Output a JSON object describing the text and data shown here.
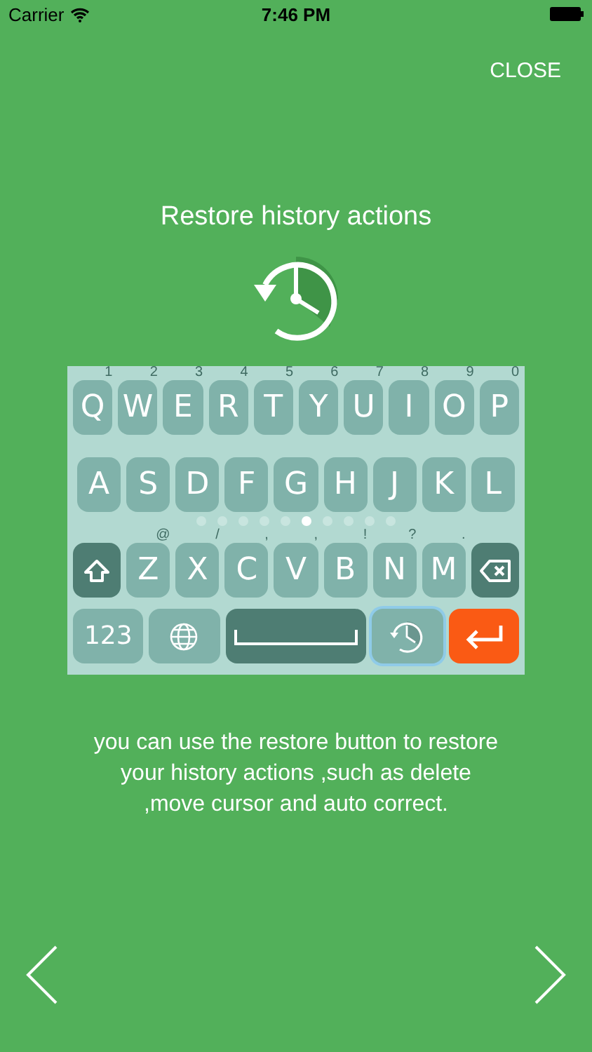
{
  "status_bar": {
    "carrier": "Carrier",
    "time": "7:46 PM"
  },
  "close": "CLOSE",
  "title": "Restore history actions",
  "keyboard": {
    "rows": [
      {
        "keys": [
          {
            "kind": "letter",
            "label": "Q",
            "hint": "1"
          },
          {
            "kind": "letter",
            "label": "W",
            "hint": "2"
          },
          {
            "kind": "letter",
            "label": "E",
            "hint": "3"
          },
          {
            "kind": "letter",
            "label": "R",
            "hint": "4"
          },
          {
            "kind": "letter",
            "label": "T",
            "hint": "5"
          },
          {
            "kind": "letter",
            "label": "Y",
            "hint": "6"
          },
          {
            "kind": "letter",
            "label": "U",
            "hint": "7"
          },
          {
            "kind": "letter",
            "label": "I",
            "hint": "8"
          },
          {
            "kind": "letter",
            "label": "O",
            "hint": "9"
          },
          {
            "kind": "letter",
            "label": "P",
            "hint": "0"
          }
        ]
      },
      {
        "keys": [
          {
            "kind": "letter",
            "label": "A"
          },
          {
            "kind": "letter",
            "label": "S"
          },
          {
            "kind": "letter",
            "label": "D"
          },
          {
            "kind": "letter",
            "label": "F"
          },
          {
            "kind": "letter",
            "label": "G"
          },
          {
            "kind": "letter",
            "label": "H"
          },
          {
            "kind": "letter",
            "label": "J"
          },
          {
            "kind": "letter",
            "label": "K"
          },
          {
            "kind": "letter",
            "label": "L"
          }
        ]
      },
      {
        "keys": [
          {
            "kind": "shift"
          },
          {
            "kind": "letter",
            "label": "Z",
            "hint": "@"
          },
          {
            "kind": "letter",
            "label": "X",
            "hint": "/"
          },
          {
            "kind": "letter",
            "label": "C",
            "hint": ","
          },
          {
            "kind": "letter",
            "label": "V",
            "hint": ","
          },
          {
            "kind": "letter",
            "label": "B",
            "hint": "!"
          },
          {
            "kind": "letter",
            "label": "N",
            "hint": "?"
          },
          {
            "kind": "letter",
            "label": "M",
            "hint": "."
          },
          {
            "kind": "backspace"
          }
        ]
      },
      {
        "keys": [
          {
            "kind": "numbers",
            "label": "123"
          },
          {
            "kind": "globe"
          },
          {
            "kind": "space"
          },
          {
            "kind": "restore",
            "selected": true
          },
          {
            "kind": "return"
          }
        ]
      }
    ],
    "dots": [
      {
        "selected": false
      },
      {
        "selected": false
      },
      {
        "selected": false
      },
      {
        "selected": false
      },
      {
        "selected": false
      },
      {
        "selected": true
      },
      {
        "selected": false
      },
      {
        "selected": false
      },
      {
        "selected": false
      },
      {
        "selected": false
      }
    ]
  },
  "description": "you can use the restore button to restore your history actions ,such as delete ,move cursor and auto correct."
}
